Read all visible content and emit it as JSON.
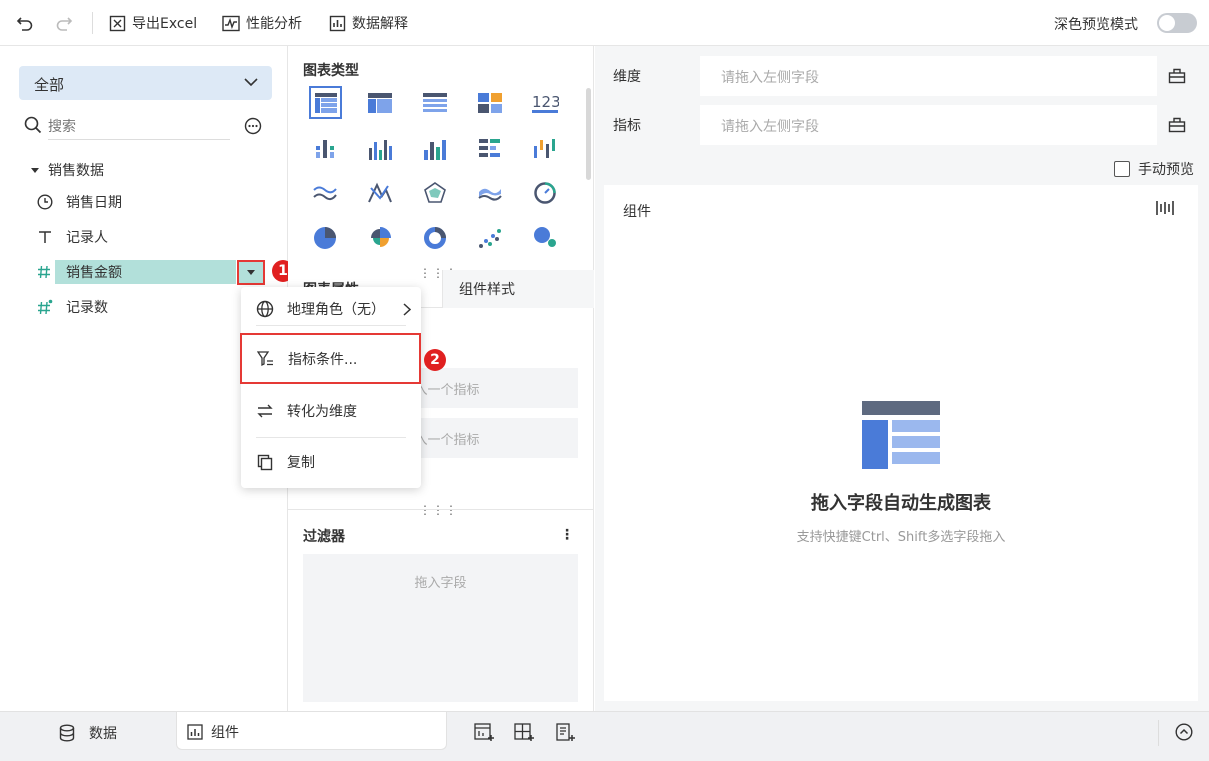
{
  "toolbar": {
    "export_excel": "导出Excel",
    "performance": "性能分析",
    "data_explain": "数据解释",
    "dark_preview": "深色预览模式"
  },
  "left": {
    "dropdown_value": "全部",
    "search_placeholder": "搜索",
    "table_name": "销售数据",
    "fields": [
      {
        "label": "销售日期",
        "icon": "clock-icon"
      },
      {
        "label": "记录人",
        "icon": "text-icon"
      },
      {
        "label": "销售金额",
        "icon": "hash-icon"
      },
      {
        "label": "记录数",
        "icon": "hash-star-icon"
      }
    ],
    "badge1": "1",
    "badge2": "2"
  },
  "menu": {
    "geo_role": "地理角色（无）",
    "metric_condition": "指标条件...",
    "to_dimension": "转化为维度",
    "copy": "复制"
  },
  "middle": {
    "chart_type_title": "图表类型",
    "tab_partial": "图表属性",
    "tab_style": "组件样式",
    "metric_ph1": "拖入一个指标",
    "metric_ph2": "拖入一个指标",
    "filter_title": "过滤器",
    "filter_drop": "拖入字段"
  },
  "right": {
    "dimension_label": "维度",
    "dimension_ph": "请拖入左侧字段",
    "metric_label": "指标",
    "metric_ph": "请拖入左侧字段",
    "manual_preview": "手动预览",
    "component_label": "组件",
    "empty_title": "拖入字段自动生成图表",
    "empty_sub": "支持快捷键Ctrl、Shift多选字段拖入"
  },
  "bottom": {
    "data_tab": "数据",
    "component_tab": "组件"
  },
  "colors": {
    "accent": "#4a7bd8",
    "highlight": "#b2e0da",
    "red": "#e53935"
  }
}
